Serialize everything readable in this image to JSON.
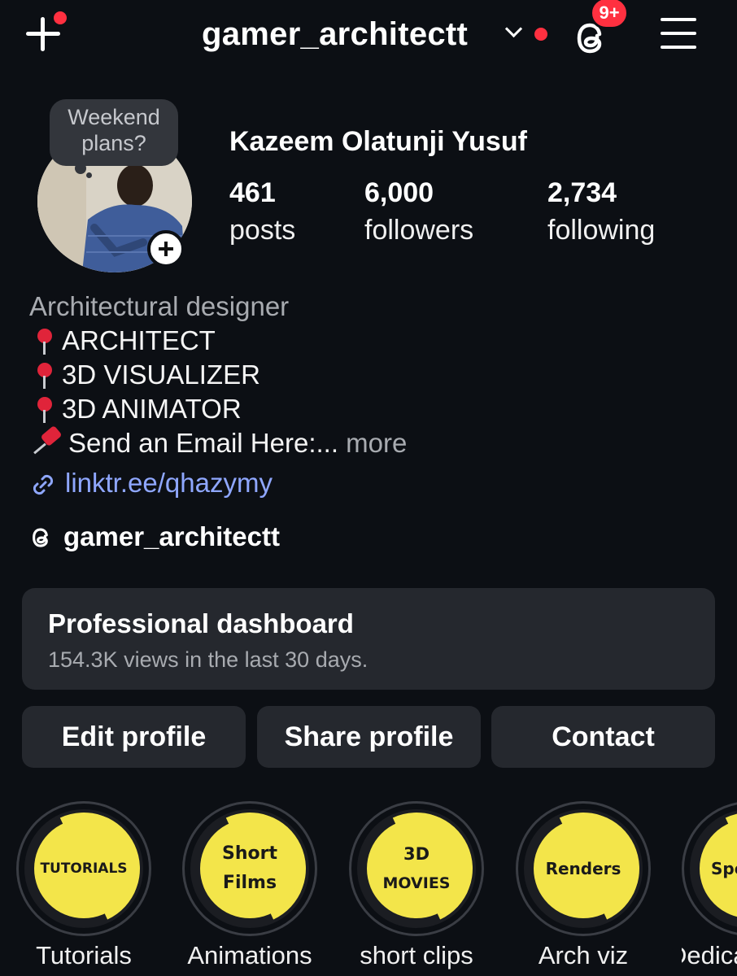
{
  "header": {
    "username": "gamer_architectt",
    "threads_badge": "9+"
  },
  "profile": {
    "note": "Weekend plans?",
    "full_name": "Kazeem Olatunji Yusuf",
    "stats": [
      {
        "value": "461",
        "label": "posts"
      },
      {
        "value": "6,000",
        "label": "followers"
      },
      {
        "value": "2,734",
        "label": "following"
      }
    ]
  },
  "bio": {
    "category": "Architectural designer",
    "lines": [
      "ARCHITECT",
      "3D VISUALIZER",
      "3D ANIMATOR"
    ],
    "email_line": "Send an Email Here:...",
    "more": "more",
    "link": "linktr.ee/qhazymy",
    "threads_handle": "gamer_architectt"
  },
  "dashboard": {
    "title": "Professional dashboard",
    "subtitle": "154.3K views in the last 30 days."
  },
  "actions": {
    "edit": "Edit profile",
    "share": "Share profile",
    "contact": "Contact"
  },
  "highlights": [
    {
      "cover": "TUTORIALS",
      "label": "Tutorials"
    },
    {
      "cover_line1": "Short",
      "cover_line2": "Films",
      "label": "Animations"
    },
    {
      "cover_line1": "3D",
      "cover_line2": "MOVIES",
      "label": "short clips"
    },
    {
      "cover": "Renders",
      "label": "Arch viz"
    },
    {
      "cover": "Spe",
      "label": "Dedica"
    }
  ],
  "colors": {
    "background": "#0c0f14",
    "card": "#25282e",
    "notification_red": "#ff3040",
    "link_blue": "#8fa7ff",
    "highlight_yellow": "#f3e54a",
    "muted_text": "#a8abb0"
  },
  "icons": [
    "plus-icon",
    "chevron-down-icon",
    "threads-icon",
    "hamburger-menu-icon",
    "link-icon",
    "round-pushpin-emoji",
    "pushpin-emoji"
  ]
}
